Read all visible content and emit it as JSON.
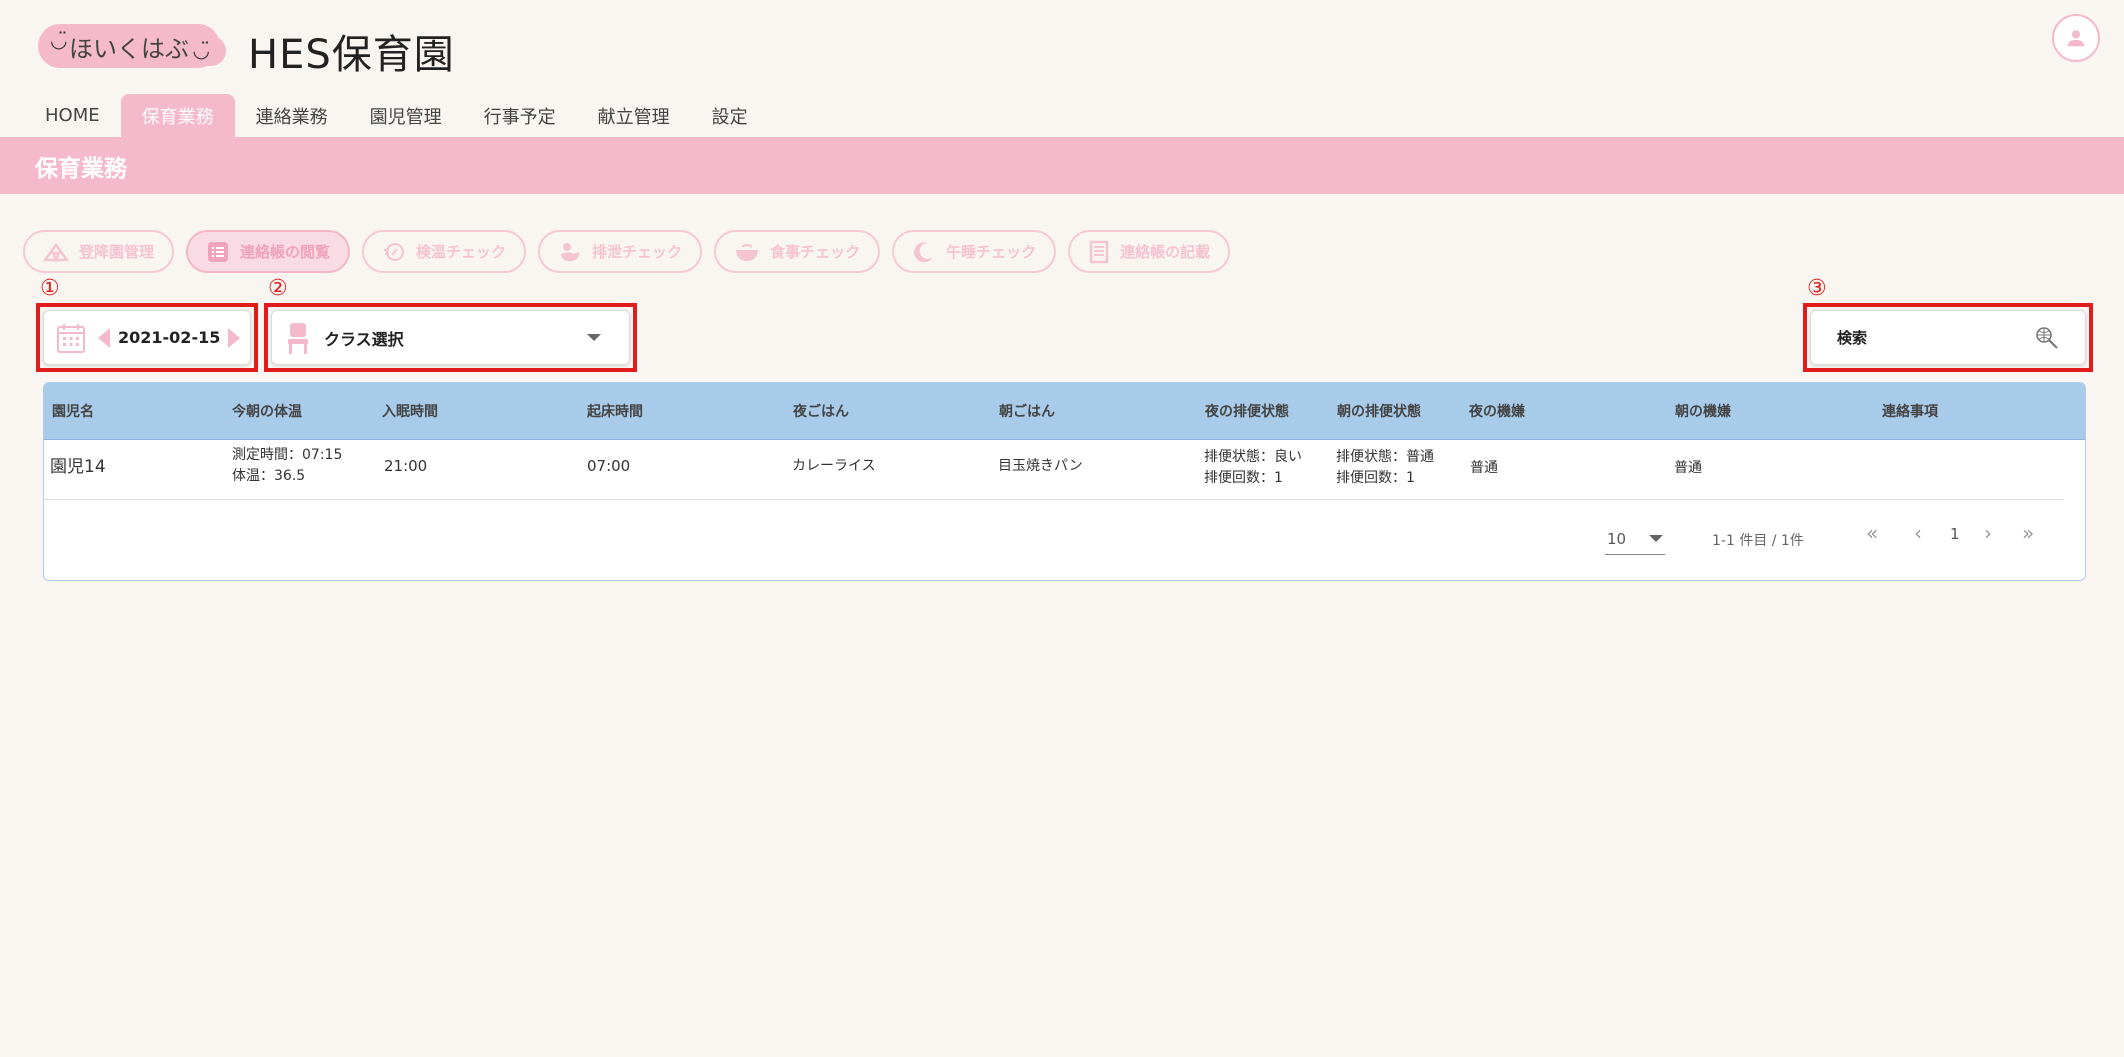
{
  "brand": {
    "logo_text": "ほいくはぶ",
    "app_title": "HES保育園"
  },
  "icons": {
    "avatar": "user-icon"
  },
  "nav": {
    "items": [
      {
        "label": "HOME",
        "active": false
      },
      {
        "label": "保育業務",
        "active": true
      },
      {
        "label": "連絡業務",
        "active": false
      },
      {
        "label": "園児管理",
        "active": false
      },
      {
        "label": "行事予定",
        "active": false
      },
      {
        "label": "献立管理",
        "active": false
      },
      {
        "label": "設定",
        "active": false
      }
    ]
  },
  "section_title": "保育業務",
  "func_tabs": [
    {
      "label": "登降園管理",
      "icon": "tent-icon",
      "active": false
    },
    {
      "label": "連絡帳の閲覧",
      "icon": "list-icon",
      "active": true
    },
    {
      "label": "検温チェック",
      "icon": "thermometer-icon",
      "active": false
    },
    {
      "label": "排泄チェック",
      "icon": "duck-icon",
      "active": false
    },
    {
      "label": "食事チェック",
      "icon": "bowl-icon",
      "active": false
    },
    {
      "label": "午睡チェック",
      "icon": "moon-icon",
      "active": false
    },
    {
      "label": "連絡帳の記載",
      "icon": "notebook-icon",
      "active": false
    }
  ],
  "markers": [
    "①",
    "②",
    "③"
  ],
  "date_picker": {
    "value": "2021-02-15"
  },
  "class_select": {
    "value": "クラス選択"
  },
  "search": {
    "placeholder": "検索"
  },
  "table": {
    "headers": [
      "園児名",
      "今朝の体温",
      "入眠時間",
      "起床時間",
      "夜ごはん",
      "朝ごはん",
      "夜の排便状態",
      "朝の排便状態",
      "夜の機嫌",
      "朝の機嫌",
      "連絡事項"
    ],
    "rows": [
      {
        "name": "園児14",
        "temp_time": "測定時間：07:15",
        "temp": "体温：36.5",
        "sleep": "21:00",
        "wake": "07:00",
        "dinner": "カレーライス",
        "breakfast": "目玉焼きパン",
        "night_stool_state": "排便状態：良い",
        "night_stool_count": "排便回数：1",
        "morning_stool_state": "排便状態：普通",
        "morning_stool_count": "排便回数：1",
        "night_mood": "普通",
        "morning_mood": "普通",
        "note": ""
      }
    ]
  },
  "pagination": {
    "per_page": "10",
    "range": "1-1 件目 / 1件",
    "current_page": "1"
  },
  "colors": {
    "pink": "#f5b9cc",
    "blue_header": "#a9cbea",
    "red_marker": "#e01c1c"
  }
}
